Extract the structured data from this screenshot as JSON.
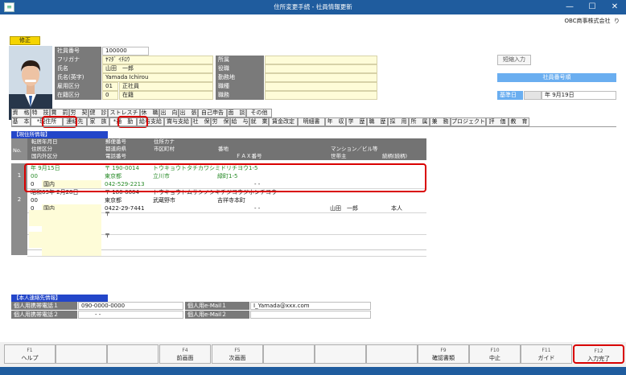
{
  "window": {
    "title": "住所変更手続 - 社員情報更新",
    "company": "OBC商事株式会社",
    "help_glyph": "り",
    "icon": "app-icon",
    "min": "—",
    "max": "☐",
    "close": "✕"
  },
  "mode": {
    "badge": "修正"
  },
  "employee": {
    "labels": {
      "no": "社員番号",
      "furigana": "フリガナ",
      "name": "氏名",
      "name_en": "氏名(英字)",
      "emp_type": "雇用区分",
      "status": "在籍区分",
      "dept": "所属",
      "post": "役職",
      "location": "勤務地",
      "job_type": "職種",
      "job": "職務"
    },
    "values": {
      "no": "100000",
      "furigana": "ﾔﾏﾀﾞ ｲﾁﾛｳ",
      "name": "山田　一郎",
      "name_en": "Yamada Ichirou",
      "emp_type_code": "01",
      "emp_type_name": "正社員",
      "status_code": "0",
      "status_name": "在籍"
    }
  },
  "side": {
    "short_input": "短縮入力",
    "employee_order": "社員番号順",
    "base_date_label": "基準日",
    "base_date": "年 9月19日"
  },
  "tabs_row1": [
    "資　格",
    "特　技",
    "賞　罰",
    "労　契",
    "健　診",
    "ストレスチ",
    "休　職",
    "出　向",
    "出　張",
    "自己申告",
    "面　談",
    "その他"
  ],
  "tabs_row2": [
    "基　本",
    "*現住所",
    "連絡先",
    "家　族",
    "*通　勤",
    "給与支給",
    "賞与支給",
    "社　保",
    "労　保",
    "給　与",
    "就　業",
    "賃金改定",
    "明細書",
    "年　収",
    "学　歴",
    "職　歴",
    "採　用",
    "所　属",
    "兼　務",
    "プロジェクト",
    "評　価",
    "教　育"
  ],
  "address": {
    "section_title": "【現住所情報】",
    "no_header": "No.",
    "headers_r1": [
      "転居年月日",
      "郵便番号",
      "住所カナ"
    ],
    "headers_r2": [
      "住居区分",
      "都道府県",
      "市区町村",
      "番地",
      "マンション／ビル等"
    ],
    "headers_r3": [
      "国内外区分",
      "電話番号",
      "ＦＡＸ番号",
      "世帯主",
      "続柄(続柄)"
    ],
    "rows": [
      {
        "no": "1",
        "date": "年  9月15日",
        "zip": "〒  190-0014",
        "kana": "トウキョウトタチカワシミドリチヨウ1-5",
        "residence": "00",
        "pref": "東京都",
        "city": "立川市",
        "street": "緑町1-5",
        "building": "",
        "domestic_code": "0",
        "domestic": "国内",
        "tel": "042-529-2213",
        "fax": "-    -",
        "householder": "",
        "relation": ""
      },
      {
        "no": "2",
        "date": "昭和63年  2月28日",
        "zip": "〒  180-0004",
        "kana": "トウキョウトムサシノシキチジヨウジホンチヨウ",
        "residence": "00",
        "pref": "東京都",
        "city": "武蔵野市",
        "street": "吉祥寺本町",
        "building": "",
        "domestic_code": "0",
        "domestic": "国内",
        "tel": "0422-29-7441",
        "fax": "-    -",
        "householder": "山田　一郎",
        "relation": "本人"
      },
      {
        "no": "",
        "date": "",
        "zip": "〒",
        "kana": "",
        "residence": "",
        "pref": "",
        "city": "",
        "street": "",
        "building": "",
        "domestic_code": "",
        "domestic": "",
        "tel": "",
        "fax": "",
        "householder": "",
        "relation": ""
      },
      {
        "no": "",
        "date": "",
        "zip": "〒",
        "kana": "",
        "residence": "",
        "pref": "",
        "city": "",
        "street": "",
        "building": "",
        "domestic_code": "",
        "domestic": "",
        "tel": "",
        "fax": "",
        "householder": "",
        "relation": ""
      }
    ]
  },
  "contact": {
    "section_title": "【本人連絡先情報】",
    "mobile1_label": "個人用携帯電話１",
    "mobile1": "090-0000-0000",
    "mobile2_label": "個人用携帯電話２",
    "mobile2": "-    -",
    "email1_label": "個人用e-Mail１",
    "email1": "I_Yamada@xxx.com",
    "email2_label": "個人用e-Mail２",
    "email2": ""
  },
  "fkeys": [
    {
      "key": "F1",
      "label": "ヘルプ"
    },
    {
      "key": "",
      "label": ""
    },
    {
      "key": "",
      "label": ""
    },
    {
      "key": "F4",
      "label": "前画面"
    },
    {
      "key": "F5",
      "label": "次画面"
    },
    {
      "key": "",
      "label": ""
    },
    {
      "key": "",
      "label": ""
    },
    {
      "key": "",
      "label": ""
    },
    {
      "key": "F9",
      "label": "確認書類"
    },
    {
      "key": "F10",
      "label": "中止"
    },
    {
      "key": "F11",
      "label": "ガイド"
    },
    {
      "key": "F12",
      "label": "入力完了"
    }
  ],
  "colors": {
    "title_bar": "#1f5c9e",
    "highlight": "#d90000",
    "kana_green": "#2a8c2a",
    "section_blue": "#2346c9"
  }
}
